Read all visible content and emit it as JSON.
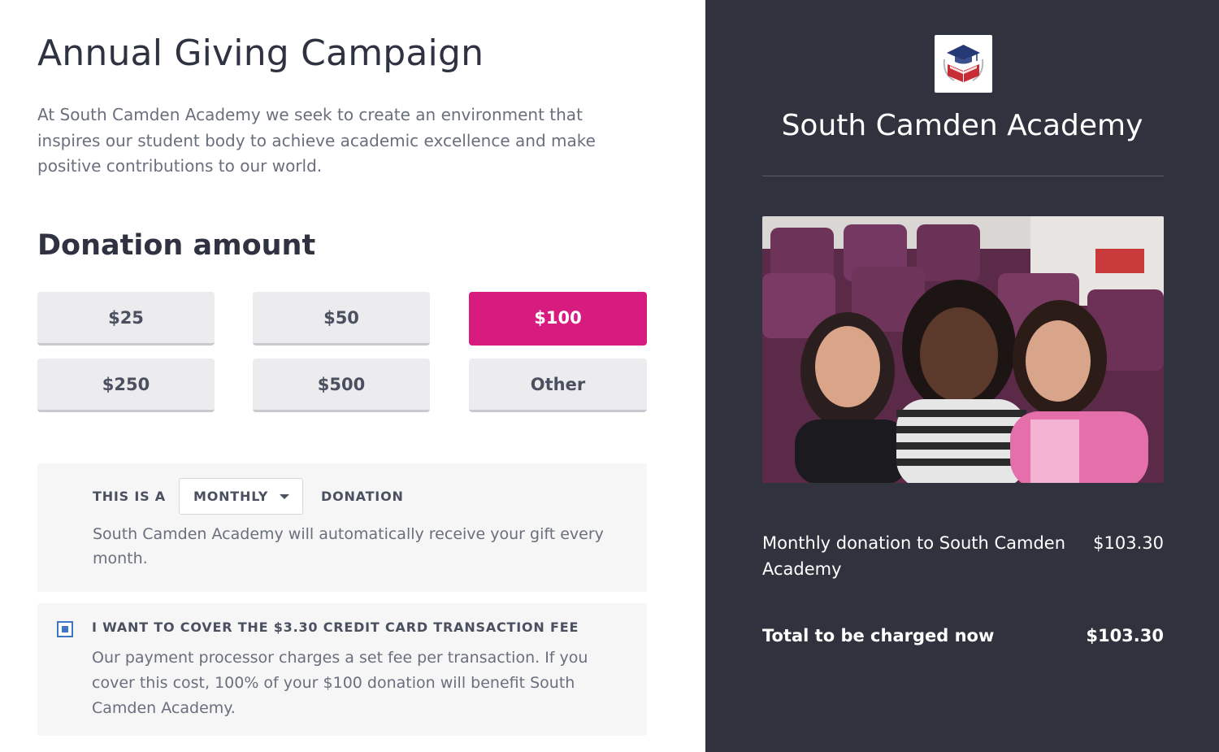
{
  "campaign": {
    "title": "Annual Giving Campaign",
    "intro": "At South Camden Academy we seek to create an environment that inspires our student body to achieve academic excellence and make positive contributions to our world."
  },
  "donation": {
    "heading": "Donation amount",
    "amounts": [
      "$25",
      "$50",
      "$100",
      "$250",
      "$500",
      "Other"
    ],
    "selected_amount": "$100"
  },
  "frequency": {
    "prefix": "THIS IS A",
    "selected": "MONTHLY",
    "suffix": "DONATION",
    "note": "South Camden Academy will automatically receive your gift every month."
  },
  "fee": {
    "checked": true,
    "label": "I WANT TO COVER THE $3.30 CREDIT CARD TRANSACTION FEE",
    "note": "Our payment processor charges a set fee per transaction. If you cover this cost, 100% of your $100 donation will benefit South Camden Academy."
  },
  "summary": {
    "org_name": "South Camden Academy",
    "line_label": "Monthly donation to South Camden Academy",
    "line_amount": "$103.30",
    "total_label": "Total to be charged now",
    "total_amount": "$103.30"
  },
  "colors": {
    "accent": "#d81b7f",
    "sidebar_bg": "#30323e",
    "checkbox": "#3f78c2"
  },
  "icons": {
    "logo": "graduation-cap-book-logo-icon",
    "dropdown": "caret-down-icon"
  }
}
